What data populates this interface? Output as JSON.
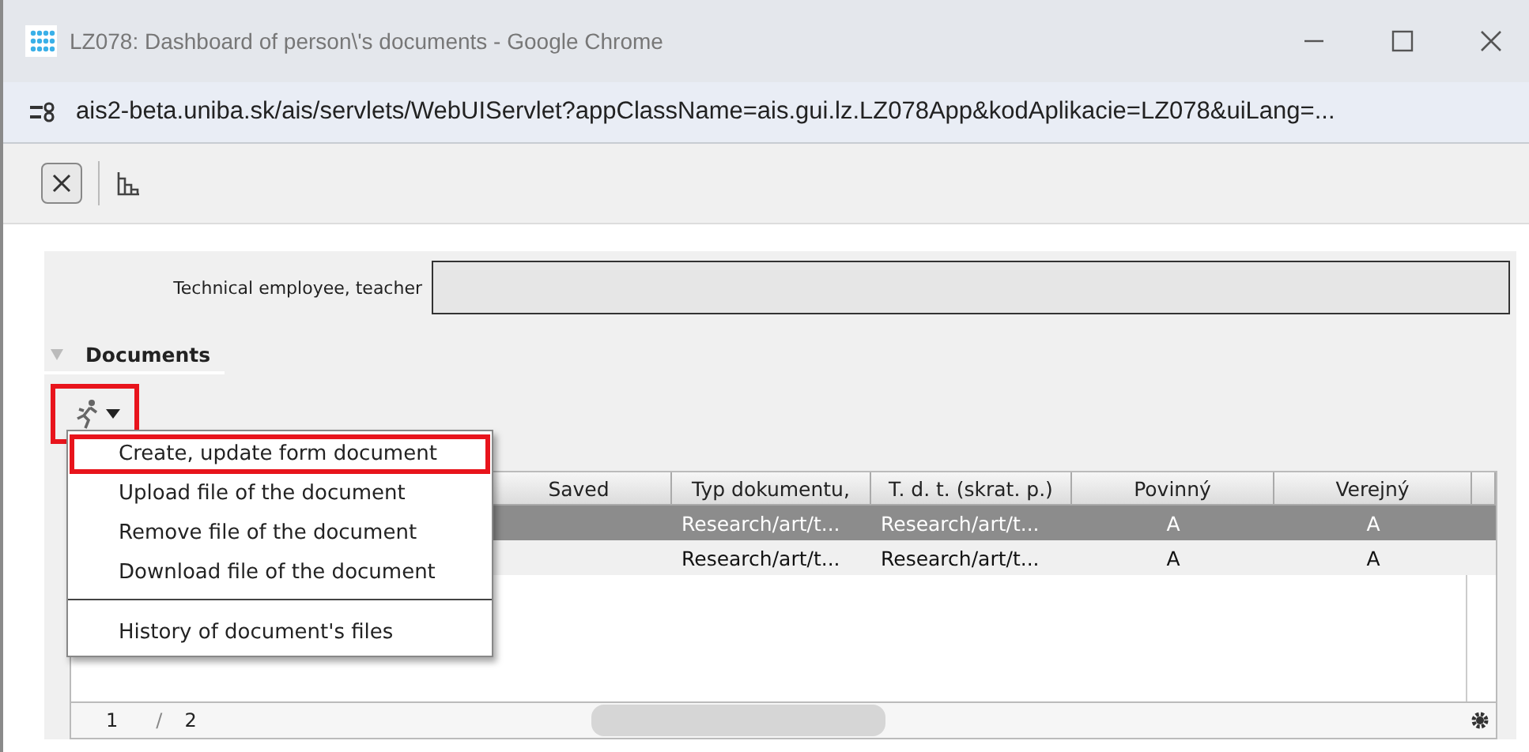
{
  "window": {
    "title": "LZ078: Dashboard of person\\'s documents - Google Chrome",
    "url": "ais2-beta.uniba.sk/ais/servlets/WebUIServlet?appClassName=ais.gui.lz.LZ078App&kodAplikacie=LZ078&uiLang=..."
  },
  "form": {
    "label": "Technical employee, teacher"
  },
  "section": {
    "title": "Documents",
    "expanded": true
  },
  "action_button": {
    "highlighted": true
  },
  "menu": [
    {
      "label": "Create, update form document",
      "highlighted": true
    },
    {
      "label": "Upload file of the document",
      "highlighted": false
    },
    {
      "label": "Remove file of the document",
      "highlighted": false
    },
    {
      "label": "Download file of the document",
      "highlighted": false
    },
    {
      "kind": "separator"
    },
    {
      "label": "History of document's files",
      "highlighted": false
    }
  ],
  "table": {
    "columns": [
      "Saved",
      "Typ dokumentu,",
      "T. d. t. (skrat. p.)",
      "Povinný",
      "Verejný"
    ],
    "rows": [
      {
        "selected": true,
        "cells": [
          "",
          "Research/art/t...",
          "Research/art/t...",
          "A",
          "A"
        ]
      },
      {
        "selected": false,
        "cells": [
          "",
          "Research/art/t...",
          "Research/art/t...",
          "A",
          "A"
        ]
      }
    ],
    "pager": {
      "page": "1",
      "separator": "/",
      "pages": "2"
    }
  }
}
